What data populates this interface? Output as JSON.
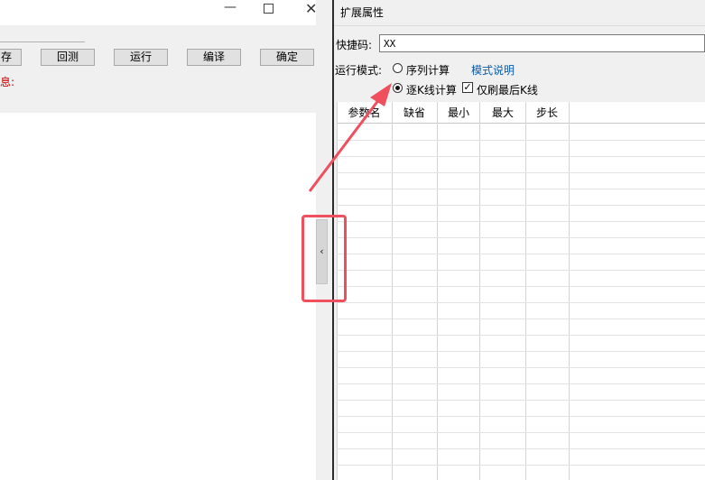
{
  "left_window": {
    "buttons": [
      {
        "label": "存"
      },
      {
        "label": "回测"
      },
      {
        "label": "运行"
      },
      {
        "label": "编译"
      },
      {
        "label": "确定"
      }
    ],
    "message_label": "息:",
    "window_controls": {
      "minimize": "—",
      "maximize": "",
      "close": "✕"
    }
  },
  "collapse_button": {
    "glyph": "‹"
  },
  "panel": {
    "title": "扩展属性",
    "hotkey": {
      "label": "快捷码:",
      "value": "XX"
    },
    "run_mode": {
      "label": "运行模式:",
      "options": [
        {
          "label": "序列计算",
          "selected": false
        },
        {
          "label": "逐K线计算",
          "selected": true
        }
      ],
      "checkbox": {
        "label": "仅刷最后K线",
        "checked": true
      },
      "help_link": "模式说明"
    },
    "grid": {
      "columns": [
        "参数名",
        "缺省",
        "最小",
        "最大",
        "步长"
      ]
    }
  },
  "annotation": {
    "color": "#f0505e"
  }
}
